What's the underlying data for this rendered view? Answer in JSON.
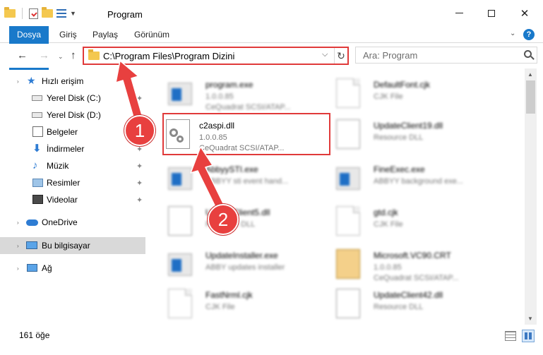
{
  "window": {
    "title": "Program"
  },
  "ribbon": {
    "tabs": [
      "Dosya",
      "Giriş",
      "Paylaş",
      "Görünüm"
    ],
    "help": "?"
  },
  "address": {
    "path": "C:\\Program Files\\Program Dizini"
  },
  "search": {
    "placeholder": "Ara: Program"
  },
  "sidebar": {
    "items": [
      {
        "label": "Hızlı erişim",
        "icon": "star-icon"
      },
      {
        "label": "Yerel Disk (C:)",
        "icon": "drive-icon"
      },
      {
        "label": "Yerel Disk (D:)",
        "icon": "drive-icon"
      },
      {
        "label": "Belgeler",
        "icon": "documents-icon"
      },
      {
        "label": "İndirmeler",
        "icon": "download-icon"
      },
      {
        "label": "Müzik",
        "icon": "music-icon"
      },
      {
        "label": "Resimler",
        "icon": "pictures-icon"
      },
      {
        "label": "Videolar",
        "icon": "videos-icon"
      },
      {
        "label": "OneDrive",
        "icon": "cloud-icon"
      },
      {
        "label": "Bu bilgisayar",
        "icon": "computer-icon"
      },
      {
        "label": "Ağ",
        "icon": "network-icon"
      }
    ]
  },
  "files": [
    {
      "name": "program.exe",
      "line1": "1.0.0.85",
      "line2": "CeQuadrat SCSI/ATAP...",
      "icon": "exe-icon",
      "blurred": true
    },
    {
      "name": "DefaultFont.cjk",
      "line1": "CJK File",
      "line2": "",
      "icon": "document-icon",
      "blurred": true
    },
    {
      "name": "c2aspi.dll",
      "line1": "1.0.0.85",
      "line2": "CeQuadrat SCSI/ATAP...",
      "icon": "dll-icon",
      "blurred": false
    },
    {
      "name": "UpdateClient19.dll",
      "line1": "Resource DLL",
      "line2": "",
      "icon": "dll-icon",
      "blurred": true
    },
    {
      "name": "AbbyySTI.exe",
      "line1": "ABBYY sti event hand...",
      "line2": "",
      "icon": "exe-icon",
      "blurred": true
    },
    {
      "name": "FineExec.exe",
      "line1": "ABBYY background exe...",
      "line2": "",
      "icon": "exe-icon",
      "blurred": true
    },
    {
      "name": "UpdateClient5.dll",
      "line1": "Resource DLL",
      "line2": "",
      "icon": "dll-icon",
      "blurred": true
    },
    {
      "name": "gtd.cjk",
      "line1": "CJK File",
      "line2": "",
      "icon": "document-icon",
      "blurred": true
    },
    {
      "name": "UpdateInstaller.exe",
      "line1": "ABBY updates installer",
      "line2": "",
      "icon": "exe-icon",
      "blurred": true
    },
    {
      "name": "Microsoft.VC90.CRT",
      "line1": "1.0.0.85",
      "line2": "CeQuadrat SCSI/ATAP...",
      "icon": "package-icon",
      "blurred": true
    },
    {
      "name": "FastNrml.cjk",
      "line1": "CJK File",
      "line2": "",
      "icon": "document-icon",
      "blurred": true
    },
    {
      "name": "UpdateClient42.dll",
      "line1": "Resource DLL",
      "line2": "",
      "icon": "dll-icon",
      "blurred": true
    }
  ],
  "status": {
    "count": "161 öğe"
  },
  "callouts": {
    "one": "1",
    "two": "2"
  },
  "colors": {
    "accent": "#1979ca",
    "highlight": "#e03a3a",
    "selected_nav": "#d9d9d9"
  }
}
